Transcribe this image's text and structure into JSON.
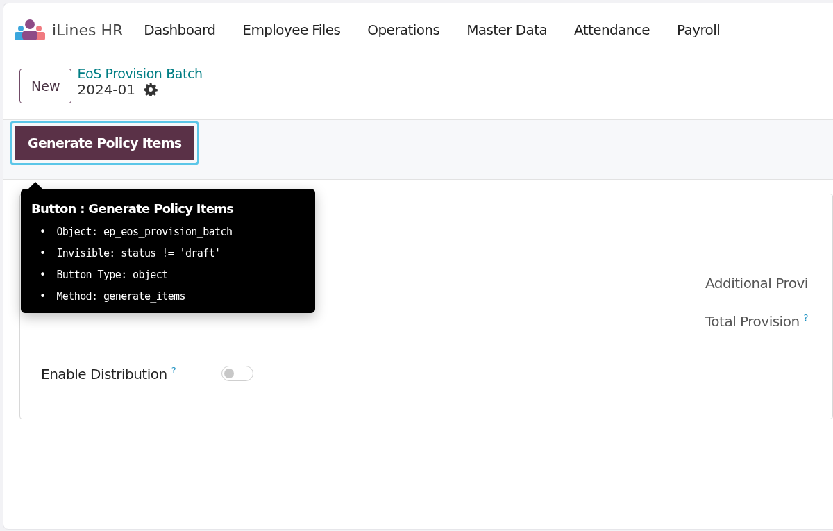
{
  "app": {
    "name": "iLines HR"
  },
  "nav": [
    {
      "label": "Dashboard"
    },
    {
      "label": "Employee Files"
    },
    {
      "label": "Operations"
    },
    {
      "label": "Master Data"
    },
    {
      "label": "Attendance"
    },
    {
      "label": "Payroll"
    }
  ],
  "control_panel": {
    "new_button": "New",
    "breadcrumb": "EoS Provision Batch",
    "record": "2024-01"
  },
  "action_button": {
    "label": "Generate Policy Items",
    "focused": true
  },
  "tooltip": {
    "title": "Button : Generate Policy Items",
    "items": [
      {
        "marker": "•",
        "key": "Object:",
        "value": "ep_eos_provision_batch"
      },
      {
        "marker": "•",
        "key": "Invisible:",
        "value": "status != 'draft'"
      },
      {
        "marker": "•",
        "key": "Button Type:",
        "value": "object"
      },
      {
        "marker": "•",
        "key": "Method:",
        "value": "generate_items"
      }
    ]
  },
  "form": {
    "left_fields": [
      {
        "label": "Enable Distribution",
        "help": "?",
        "kind": "toggle",
        "on": false
      }
    ],
    "right_fields": [
      {
        "label": "Additional Provi"
      },
      {
        "label": "Total Provision",
        "help": "?"
      }
    ]
  }
}
